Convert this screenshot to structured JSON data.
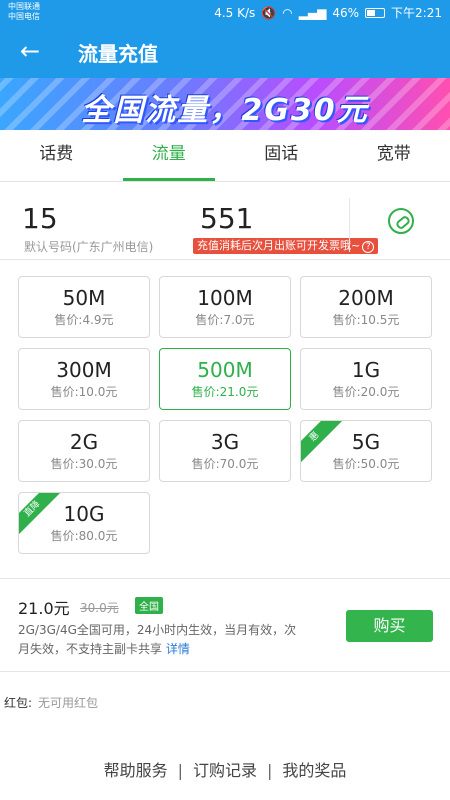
{
  "status_bar": {
    "carrier1": "中国联通",
    "carrier2": "中国电信",
    "speed": "4.5 K/s",
    "battery": "46%",
    "time": "下午2:21"
  },
  "header": {
    "title": "流量充值"
  },
  "banner": {
    "text": "全国流量，2G30元"
  },
  "tabs": [
    {
      "label": "话费",
      "active": false
    },
    {
      "label": "流量",
      "active": true
    },
    {
      "label": "固话",
      "active": false
    },
    {
      "label": "宽带",
      "active": false
    }
  ],
  "phone": {
    "part1": "15",
    "part2": "551",
    "subtitle": "默认号码(广东广州电信)",
    "invoice_tip": "充值消耗后次月出账可开发票哦~"
  },
  "packages": [
    {
      "size": "50M",
      "price": "售价:4.9元"
    },
    {
      "size": "100M",
      "price": "售价:7.0元"
    },
    {
      "size": "200M",
      "price": "售价:10.5元"
    },
    {
      "size": "300M",
      "price": "售价:10.0元"
    },
    {
      "size": "500M",
      "price": "售价:21.0元",
      "selected": true
    },
    {
      "size": "1G",
      "price": "售价:20.0元"
    },
    {
      "size": "2G",
      "price": "售价:30.0元"
    },
    {
      "size": "3G",
      "price": "售价:70.0元"
    },
    {
      "size": "5G",
      "price": "售价:50.0元",
      "tag": "惠"
    },
    {
      "size": "10G",
      "price": "售价:80.0元",
      "tag": "直降"
    }
  ],
  "summary": {
    "price": "21.0元",
    "original_price": "30.0元",
    "badge": "全国",
    "description": "2G/3G/4G全国可用，24小时内生效，当月有效，次月失效，不支持主副卡共享",
    "detail_link": "详情",
    "buy_label": "购买"
  },
  "redpack": {
    "label": "红包:",
    "value": "无可用红包"
  },
  "footer": {
    "link1": "帮助服务",
    "link2": "订购记录",
    "link3": "我的奖品",
    "separator": "|"
  },
  "colors": {
    "primary": "#1f9ae8",
    "accent_green": "#2fb04a",
    "warning_red": "#e8503e"
  }
}
